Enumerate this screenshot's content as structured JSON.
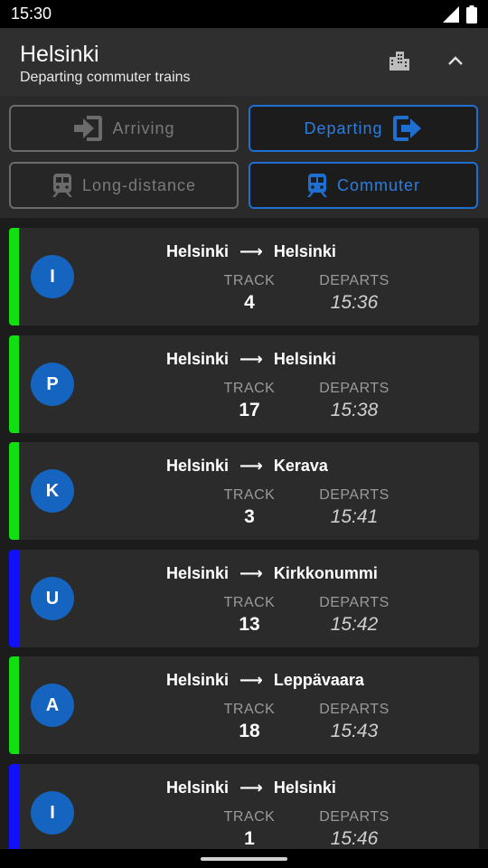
{
  "status": {
    "time": "15:30"
  },
  "header": {
    "title": "Helsinki",
    "subtitle": "Departing commuter trains"
  },
  "filters": {
    "arriving": "Arriving",
    "departing": "Departing",
    "long_distance": "Long-distance",
    "commuter": "Commuter",
    "active": [
      "departing",
      "commuter"
    ]
  },
  "labels": {
    "track": "TRACK",
    "departs": "DEPARTS",
    "arrow": "⟶"
  },
  "colors": {
    "accent": "#1e6fd0",
    "green": "#10e010",
    "blue": "#1010ff",
    "badge": "#1565c0"
  },
  "trains": [
    {
      "line": "I",
      "from": "Helsinki",
      "to": "Helsinki",
      "track": "4",
      "time": "15:36",
      "color": "green"
    },
    {
      "line": "P",
      "from": "Helsinki",
      "to": "Helsinki",
      "track": "17",
      "time": "15:38",
      "color": "green"
    },
    {
      "line": "K",
      "from": "Helsinki",
      "to": "Kerava",
      "track": "3",
      "time": "15:41",
      "color": "green"
    },
    {
      "line": "U",
      "from": "Helsinki",
      "to": "Kirkkonummi",
      "track": "13",
      "time": "15:42",
      "color": "blue"
    },
    {
      "line": "A",
      "from": "Helsinki",
      "to": "Leppävaara",
      "track": "18",
      "time": "15:43",
      "color": "green"
    },
    {
      "line": "I",
      "from": "Helsinki",
      "to": "Helsinki",
      "track": "1",
      "time": "15:46",
      "color": "blue"
    }
  ]
}
